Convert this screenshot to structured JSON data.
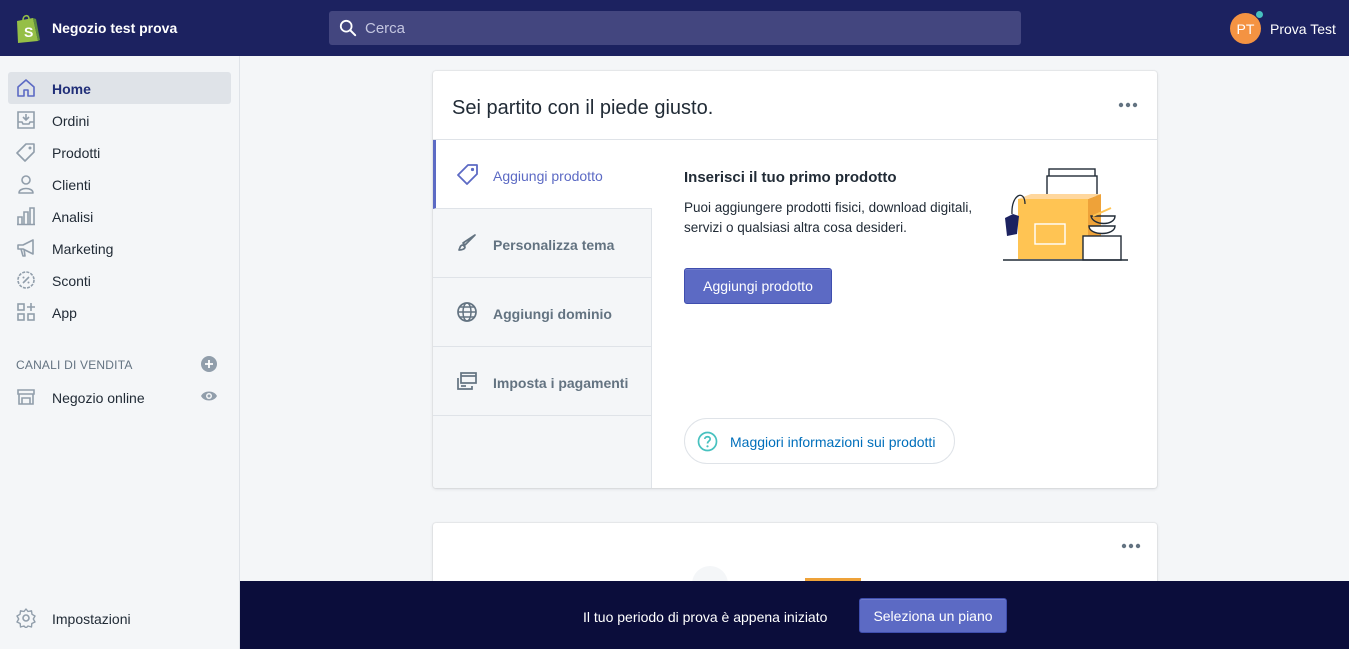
{
  "topbar": {
    "logo_icon": "shopify-bag-icon",
    "store_name": "Negozio test prova",
    "search_placeholder": "Cerca",
    "avatar_initials": "PT",
    "user_name": "Prova Test"
  },
  "sidebar": {
    "items": [
      {
        "label": "Home",
        "icon": "home-icon",
        "active": true
      },
      {
        "label": "Ordini",
        "icon": "orders-icon"
      },
      {
        "label": "Prodotti",
        "icon": "tag-icon"
      },
      {
        "label": "Clienti",
        "icon": "person-icon"
      },
      {
        "label": "Analisi",
        "icon": "bar-chart-icon"
      },
      {
        "label": "Marketing",
        "icon": "megaphone-icon"
      },
      {
        "label": "Sconti",
        "icon": "discount-icon"
      },
      {
        "label": "App",
        "icon": "apps-icon"
      }
    ],
    "sales_channels_title": "CANALI DI VENDITA",
    "online_store_label": "Negozio online",
    "settings_label": "Impostazioni"
  },
  "card1": {
    "title": "Sei partito con il piede giusto.",
    "tabs": [
      {
        "label": "Aggiungi prodotto",
        "icon": "tag-icon",
        "active": true
      },
      {
        "label": "Personalizza tema",
        "icon": "brush-icon"
      },
      {
        "label": "Aggiungi dominio",
        "icon": "globe-icon"
      },
      {
        "label": "Imposta i pagamenti",
        "icon": "payment-icon"
      }
    ],
    "panel": {
      "heading": "Inserisci il tuo primo prodotto",
      "text": "Puoi aggiungere prodotti fisici, download digitali, servizi o qualsiasi altra cosa desideri.",
      "button_label": "Aggiungi prodotto",
      "help_link": "Maggiori informazioni sui prodotti"
    }
  },
  "bottombar": {
    "text": "Il tuo periodo di prova è appena iniziato",
    "button_label": "Seleziona un piano"
  },
  "colors": {
    "topbar": "#1c2260",
    "accent": "#5c6ac4",
    "bottombar": "#0b0d3b",
    "link": "#006fbb",
    "avatar": "#f49342"
  }
}
